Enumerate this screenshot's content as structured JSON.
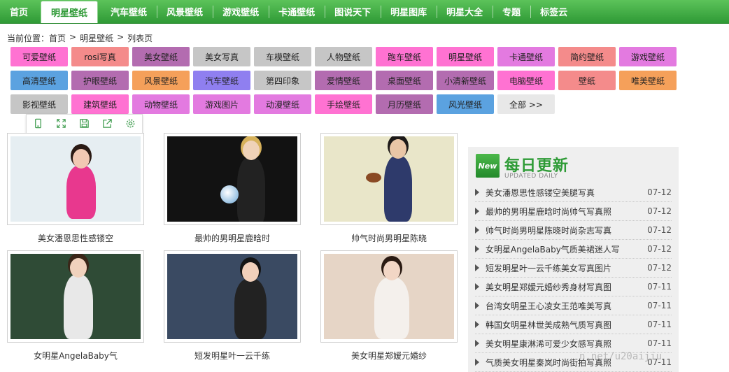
{
  "nav": [
    "首页",
    "明星壁纸",
    "汽车壁纸",
    "风景壁纸",
    "游戏壁纸",
    "卡通壁纸",
    "图说天下",
    "明星图库",
    "明星大全",
    "专题",
    "标签云"
  ],
  "breadcrumb": [
    "当前位置：首页",
    ">",
    "明星壁纸",
    ">",
    "列表页"
  ],
  "tags": [
    [
      {
        "label": "可爱壁纸",
        "color": "#ff72d2"
      },
      {
        "label": "rosi写真",
        "color": "#f48b8b"
      },
      {
        "label": "美女壁纸",
        "color": "#b36cb0"
      },
      {
        "label": "美女写真",
        "color": "#c6c6c6"
      },
      {
        "label": "车模壁纸",
        "color": "#c6c6c6"
      },
      {
        "label": "人物壁纸",
        "color": "#c6c6c6"
      },
      {
        "label": "跑车壁纸",
        "color": "#ff72d2"
      },
      {
        "label": "明星壁纸",
        "color": "#ff72d2"
      },
      {
        "label": "卡通壁纸",
        "color": "#e37ae0"
      },
      {
        "label": "简约壁纸",
        "color": "#f48b8b"
      },
      {
        "label": "游戏壁纸",
        "color": "#e37ae0"
      }
    ],
    [
      {
        "label": "高清壁纸",
        "color": "#5ba2e0"
      },
      {
        "label": "护眼壁纸",
        "color": "#b36cb0"
      },
      {
        "label": "风景壁纸",
        "color": "#f5a05a"
      },
      {
        "label": "汽车壁纸",
        "color": "#8f7ff0"
      },
      {
        "label": "第四印象",
        "color": "#c6c6c6"
      },
      {
        "label": "爱情壁纸",
        "color": "#b36cb0"
      },
      {
        "label": "桌面壁纸",
        "color": "#b36cb0"
      },
      {
        "label": "小清新壁纸",
        "color": "#b36cb0"
      },
      {
        "label": "电脑壁纸",
        "color": "#ff72d2"
      },
      {
        "label": "壁纸",
        "color": "#f48b8b"
      },
      {
        "label": "唯美壁纸",
        "color": "#f5a05a"
      }
    ],
    [
      {
        "label": "影视壁纸",
        "color": "#c6c6c6"
      },
      {
        "label": "建筑壁纸",
        "color": "#ff72d2"
      },
      {
        "label": "动物壁纸",
        "color": "#e37ae0"
      },
      {
        "label": "游戏图片",
        "color": "#e37ae0"
      },
      {
        "label": "动漫壁纸",
        "color": "#e37ae0"
      },
      {
        "label": "手绘壁纸",
        "color": "#ff72d2"
      },
      {
        "label": "月历壁纸",
        "color": "#b36cb0"
      },
      {
        "label": "风光壁纸",
        "color": "#5ba2e0"
      },
      {
        "label": "全部 >>",
        "color": "#e8e8e8"
      }
    ]
  ],
  "toolbar": [
    "phone-icon",
    "fullscreen-icon",
    "save-icon",
    "share-icon",
    "settings-icon"
  ],
  "gallery": [
    {
      "caption": "美女潘恩思性感镂空",
      "bg": "#e6eef2"
    },
    {
      "caption": "最帅的男明星鹿晗时",
      "bg": "#121212"
    },
    {
      "caption": "帅气时尚男明星陈晓",
      "bg": "#e9e6c9"
    },
    {
      "caption": "女明星AngelaBaby气",
      "bg": "#2f4b36"
    },
    {
      "caption": "短发明星叶一云千练",
      "bg": "#3a4a62"
    },
    {
      "caption": "美女明星郑嫒元婚纱",
      "bg": "#e6d5c6"
    }
  ],
  "daily": {
    "badge": "New",
    "title": "每日更新",
    "subtitle": "UPDATED DAILY",
    "items": [
      {
        "title": "美女潘恩思性感镂空美腿写真",
        "date": "07-12"
      },
      {
        "title": "最帅的男明星鹿晗时尚帅气写真照",
        "date": "07-12"
      },
      {
        "title": "帅气时尚男明星陈晓时尚杂志写真",
        "date": "07-12"
      },
      {
        "title": "女明星AngelaBaby气质美裙迷人写",
        "date": "07-12"
      },
      {
        "title": "短发明星叶一云千练美女写真图片",
        "date": "07-12"
      },
      {
        "title": "美女明星郑嫒元婚纱秀身材写真图",
        "date": "07-11"
      },
      {
        "title": "台湾女明星王心凌女王范唯美写真",
        "date": "07-11"
      },
      {
        "title": "韩国女明星林世美成熟气质写真图",
        "date": "07-11"
      },
      {
        "title": "美女明星康淋浠可爱少女感写真照",
        "date": "07-11"
      },
      {
        "title": "气质美女明星秦岚时尚街拍写真照",
        "date": "07-11"
      }
    ]
  },
  "watermark": "n.net/u20aijiu"
}
